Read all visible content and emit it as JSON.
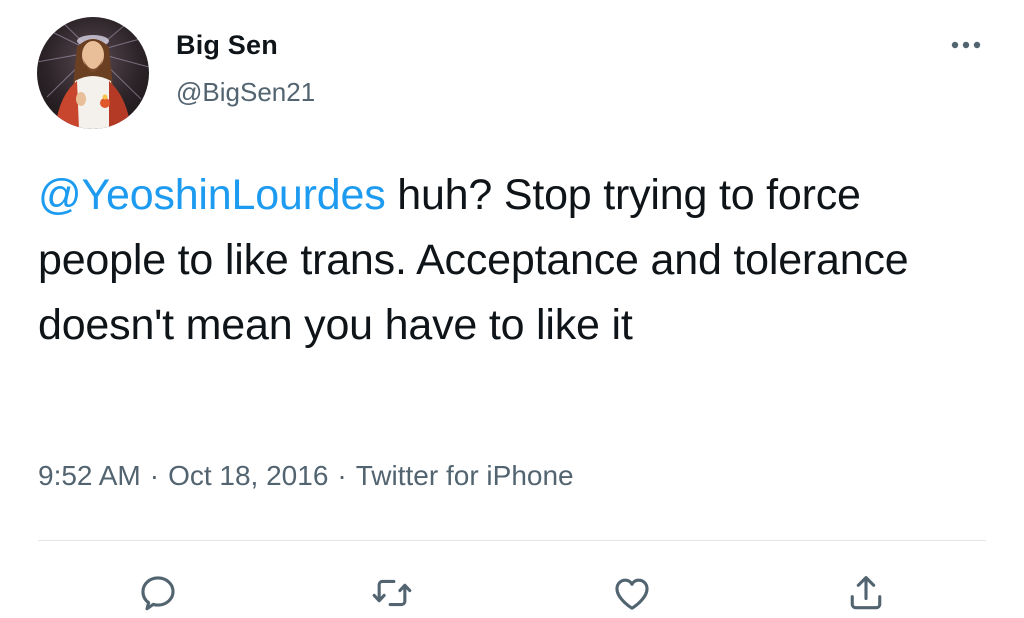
{
  "author": {
    "display_name": "Big Sen",
    "handle": "@BigSen21",
    "avatar_icon": "religious-portrait-avatar"
  },
  "tweet": {
    "mention": "@YeoshinLourdes",
    "text": " huh?  Stop trying to force people to like trans.  Acceptance and tolerance doesn't mean you have to like it"
  },
  "meta": {
    "time": "9:52 AM",
    "separator": "·",
    "date": "Oct 18, 2016",
    "source": "Twitter for iPhone"
  },
  "actions": [
    {
      "icon": "reply-icon"
    },
    {
      "icon": "retweet-icon"
    },
    {
      "icon": "like-icon"
    },
    {
      "icon": "share-icon"
    }
  ],
  "colors": {
    "mention": "#1d9bf0",
    "secondary_text": "#536471",
    "primary_text": "#0f1419",
    "divider": "#e1e6ea"
  }
}
